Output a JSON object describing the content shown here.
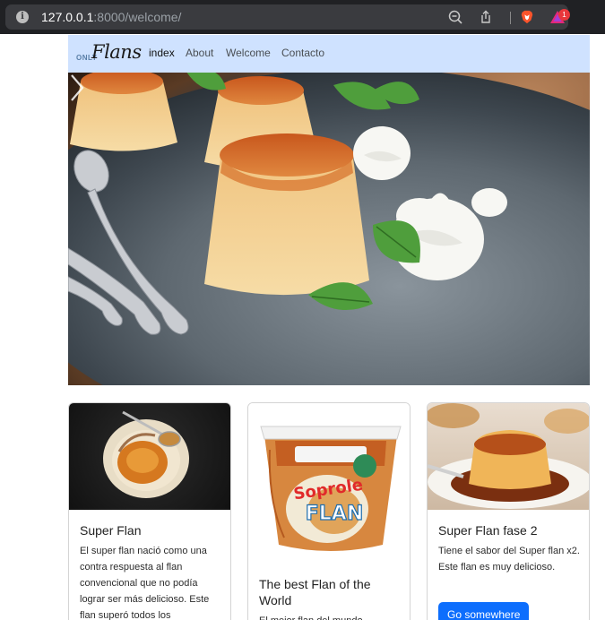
{
  "browser": {
    "url_host": "127.0.0.1",
    "url_rest": ":8000/welcome/",
    "rewards_count": "1"
  },
  "navbar": {
    "brand_small": "ONLY",
    "brand_script": "Flans",
    "links": [
      {
        "label": "index"
      },
      {
        "label": "About"
      },
      {
        "label": "Welcome"
      },
      {
        "label": "Contacto"
      }
    ]
  },
  "cards": [
    {
      "title": "Super Flan",
      "text": "El super flan nació como una contra respuesta al flan convencional que no podía lograr ser más delicioso. Este flan superó todos los"
    },
    {
      "title": "The best Flan of the World",
      "text": "El mejor flan del mundo",
      "product_brand": "Soprole",
      "product_name": "FLAN"
    },
    {
      "title": "Super Flan fase 2",
      "text": "Tiene el sabor del Super flan x2. Este flan es muy delicioso.",
      "button": "Go somewhere"
    }
  ],
  "colors": {
    "navbar_bg": "#cfe2ff",
    "primary": "#0d6efd",
    "caramel": "#d2692b"
  },
  "icons": {
    "info": "info-icon",
    "zoom": "zoom-out-icon",
    "share": "share-icon",
    "brave": "brave-lion-icon",
    "rewards": "brave-rewards-icon",
    "next": "chevron-right-icon"
  }
}
